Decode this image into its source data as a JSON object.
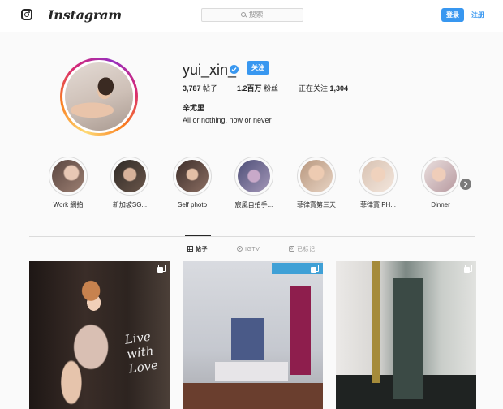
{
  "nav": {
    "brand": "Instagram",
    "search_placeholder": "搜索",
    "login_label": "登录",
    "signup_label": "注册"
  },
  "profile": {
    "username": "yui_xin_",
    "follow_label": "关注",
    "posts_count": "3,787",
    "posts_label": "帖子",
    "followers_count": "1.2百万",
    "followers_label": "粉丝",
    "following_label": "正在关注",
    "following_count": "1,304",
    "full_name": "辛尤里",
    "bio": "All or nothing, now or never"
  },
  "highlights": [
    {
      "label": "Work 網拍"
    },
    {
      "label": "新加坡SG..."
    },
    {
      "label": "Self photo"
    },
    {
      "label": "宸風自拍手..."
    },
    {
      "label": "菲律賓第三天"
    },
    {
      "label": "菲律賓 PH..."
    },
    {
      "label": "Dinner"
    }
  ],
  "tabs": {
    "posts": "帖子",
    "igtv": "IGTV",
    "tagged": "已标记"
  },
  "posts": [
    {
      "overlay_text": "Live with Love"
    },
    {
      "overlay_text": ""
    },
    {
      "overlay_text": ""
    }
  ],
  "colors": {
    "accent": "#3897f0",
    "text": "#262626",
    "muted": "#999999",
    "border": "#dbdbdb",
    "background": "#fafafa"
  },
  "icons": [
    "instagram-logo-icon",
    "search-icon",
    "verified-badge-icon",
    "chevron-right-icon",
    "grid-icon",
    "igtv-icon",
    "tagged-icon",
    "multi-post-icon"
  ]
}
